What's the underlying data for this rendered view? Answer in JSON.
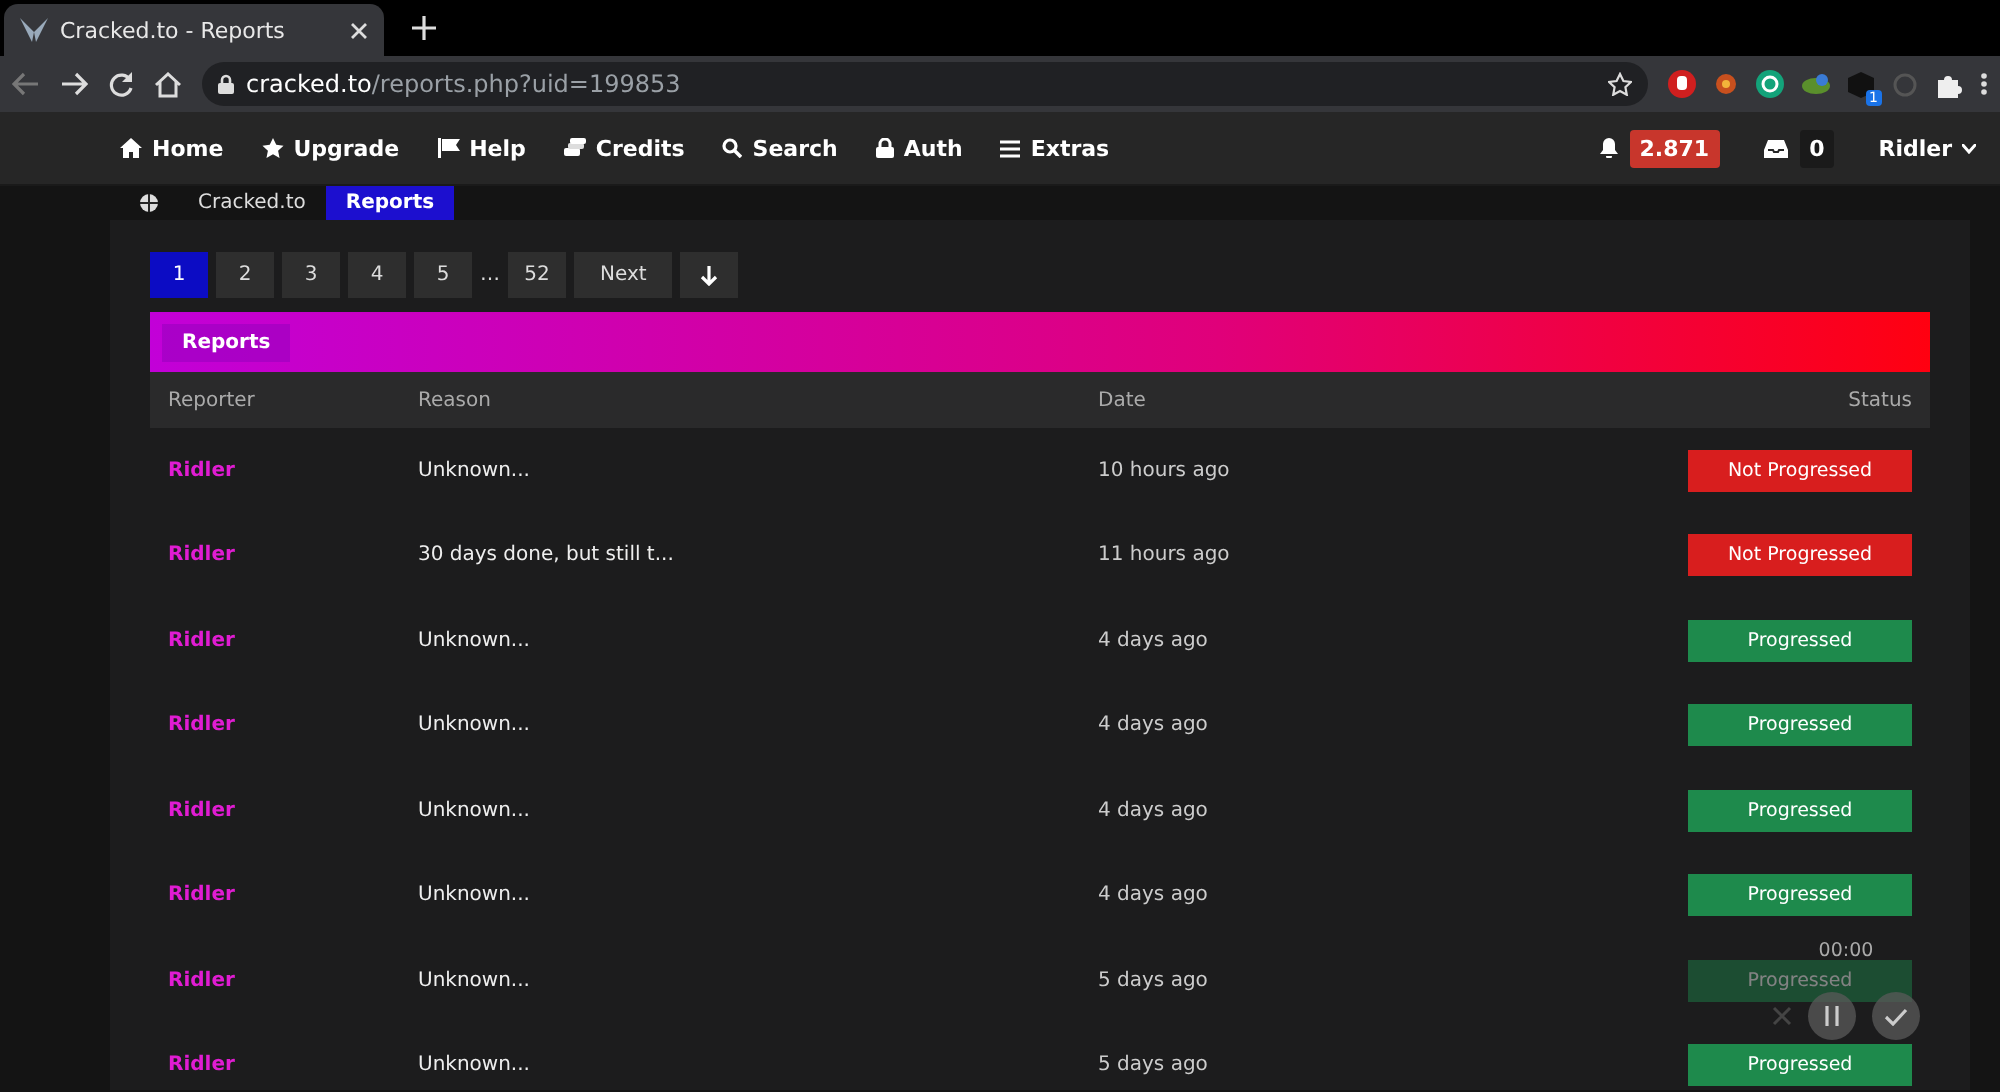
{
  "browser": {
    "tab_title": "Cracked.to - Reports",
    "url_host": "cracked.to",
    "url_path": "/reports.php?uid=199853",
    "extension_badge": "1"
  },
  "nav": {
    "items": [
      {
        "label": "Home",
        "kind": "home"
      },
      {
        "label": "Upgrade",
        "kind": "star"
      },
      {
        "label": "Help",
        "kind": "flag"
      },
      {
        "label": "Credits",
        "kind": "credits"
      },
      {
        "label": "Search",
        "kind": "search"
      },
      {
        "label": "Auth",
        "kind": "lock"
      },
      {
        "label": "Extras",
        "kind": "menu"
      }
    ],
    "notifications": "2.871",
    "inbox": "0",
    "user": "Ridler"
  },
  "breadcrumb": [
    {
      "label": "Cracked.to",
      "selected": false
    },
    {
      "label": "Reports",
      "selected": true
    }
  ],
  "pagination": [
    {
      "label": "1",
      "selected": true
    },
    {
      "label": "2",
      "selected": false
    },
    {
      "label": "3",
      "selected": false
    },
    {
      "label": "4",
      "selected": false
    },
    {
      "label": "5",
      "selected": false
    },
    {
      "label": "…",
      "kind": "gap",
      "selected": false
    },
    {
      "label": "52",
      "selected": false
    },
    {
      "label": "Next",
      "selected": false
    }
  ],
  "banner": "Reports",
  "table": {
    "columns": [
      "Reporter",
      "Reason",
      "Date",
      "Status"
    ],
    "rows": [
      {
        "reporter": "Ridler",
        "reason": "Unknown...",
        "date": "10 hours ago",
        "status": "Not Progressed",
        "kind": "not_progressed"
      },
      {
        "reporter": "Ridler",
        "reason": "30 days done, but still t...",
        "date": "11 hours ago",
        "status": "Not Progressed",
        "kind": "not_progressed"
      },
      {
        "reporter": "Ridler",
        "reason": "Unknown...",
        "date": "4 days ago",
        "status": "Progressed",
        "kind": "progressed"
      },
      {
        "reporter": "Ridler",
        "reason": "Unknown...",
        "date": "4 days ago",
        "status": "Progressed",
        "kind": "progressed"
      },
      {
        "reporter": "Ridler",
        "reason": "Unknown...",
        "date": "4 days ago",
        "status": "Progressed",
        "kind": "progressed"
      },
      {
        "reporter": "Ridler",
        "reason": "Unknown...",
        "date": "4 days ago",
        "status": "Progressed",
        "kind": "progressed"
      },
      {
        "reporter": "Ridler",
        "reason": "Unknown...",
        "date": "5 days ago",
        "status": "Progressed",
        "kind": "progressed"
      },
      {
        "reporter": "Ridler",
        "reason": "Unknown...",
        "date": "5 days ago",
        "status": "Progressed",
        "kind": "progressed"
      }
    ]
  },
  "recorder": {
    "time": "00:00"
  }
}
